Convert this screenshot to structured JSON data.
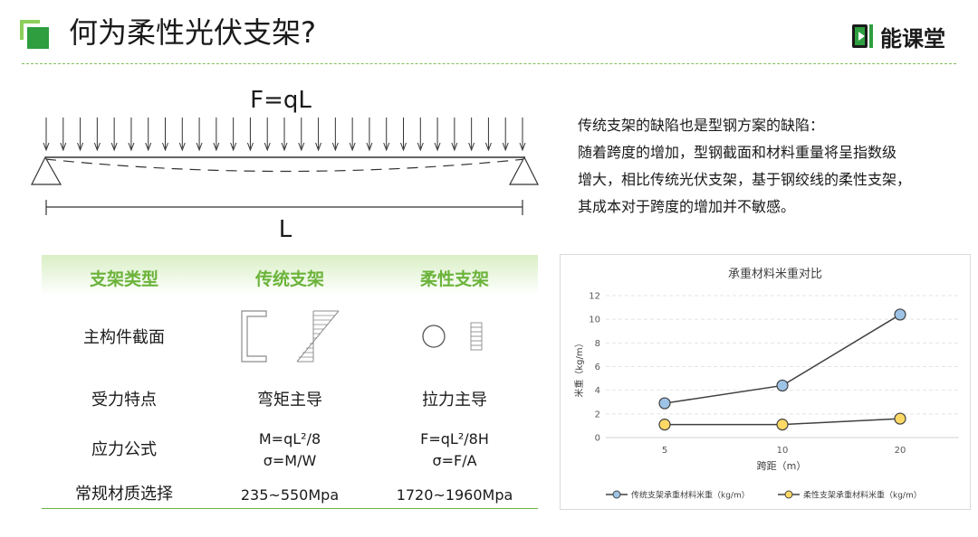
{
  "header": {
    "title": "何为柔性光伏支架?",
    "brand": "能课堂",
    "accent_color": "#2e9e3f",
    "logo_icon": "green-square-logo-icon",
    "brand_icon": "play-book-icon"
  },
  "beam_diagram": {
    "load_label": "F=qL",
    "span_label": "L",
    "arrow_count": 29
  },
  "comparison_table": {
    "headers": [
      "支架类型",
      "传统支架",
      "柔性支架"
    ],
    "rows": [
      {
        "label": "主构件截面",
        "traditional": "",
        "flexible": ""
      },
      {
        "label": "受力特点",
        "traditional": "弯矩主导",
        "flexible": "拉力主导"
      },
      {
        "label": "应力公式",
        "traditional": [
          "M=qL²/8",
          "σ=M/W"
        ],
        "flexible": [
          "F=qL²/8H",
          "σ=F/A"
        ]
      },
      {
        "label": "常规材质选择",
        "traditional": "235~550Mpa",
        "flexible": "1720~1960Mpa"
      }
    ],
    "section_icons": {
      "traditional": [
        "c-channel-section-icon",
        "bending-stress-diagram-icon"
      ],
      "flexible": [
        "circular-section-icon",
        "uniform-stress-diagram-icon"
      ]
    }
  },
  "description": {
    "lines": [
      "传统支架的缺陷也是型钢方案的缺陷：",
      "随着跨度的增加，型钢截面和材料重量将呈指数级",
      "增大，相比传统光伏支架，基于钢绞线的柔性支架，",
      "其成本对于跨度的增加并不敏感。"
    ]
  },
  "chart_data": {
    "type": "line",
    "title": "承重材料米重对比",
    "xlabel": "跨距（m）",
    "ylabel": "米重（kg/m）",
    "categories": [
      "5",
      "10",
      "20"
    ],
    "ylim": [
      0,
      12
    ],
    "yticks": [
      0,
      2,
      4,
      6,
      8,
      10,
      12
    ],
    "grid": true,
    "legend_position": "bottom",
    "series": [
      {
        "name": "传统支架承重材料米重（kg/m）",
        "values": [
          2.9,
          4.4,
          10.4
        ],
        "color": "#9dc3e6"
      },
      {
        "name": "柔性支架承重材料米重（kg/m）",
        "values": [
          1.1,
          1.1,
          1.6
        ],
        "color": "#ffd966"
      }
    ]
  }
}
